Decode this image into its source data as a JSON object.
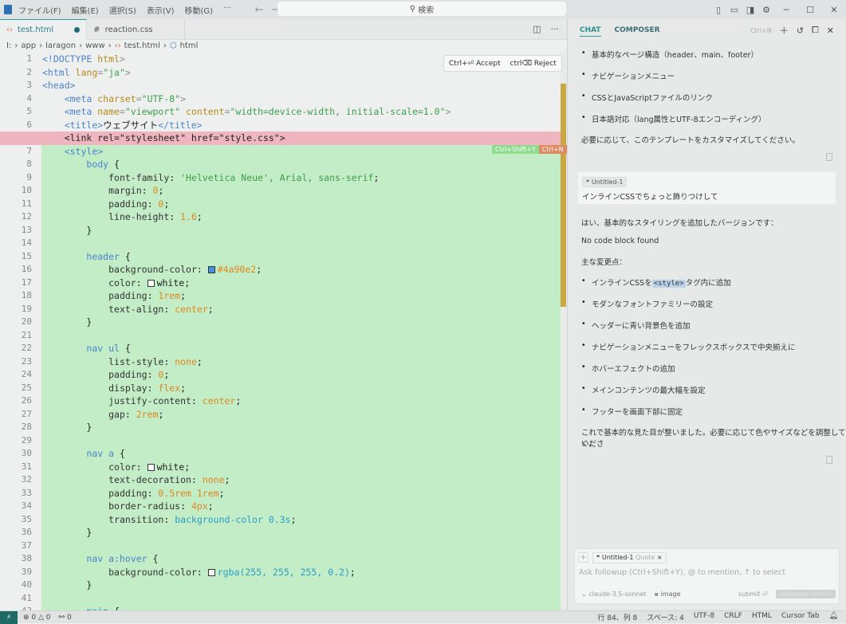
{
  "titlebar": {
    "menu": [
      "ファイル(F)",
      "編集(E)",
      "選択(S)",
      "表示(V)",
      "移動(G)",
      "···"
    ],
    "search_placeholder": "検索"
  },
  "tabs": [
    {
      "label": "test.html",
      "icon": "html-icon",
      "modified": true,
      "active": true
    },
    {
      "label": "reaction.css",
      "icon": "hash-icon",
      "active": false
    }
  ],
  "breadcrumb": [
    "I:",
    "app",
    "laragon",
    "www",
    "test.html",
    "html"
  ],
  "diff_actions": {
    "accept": "Ctrl+⏎ Accept",
    "reject": "ctrl⌫ Reject",
    "accept_short": "Ctrl+Shift+Y",
    "reject_short": "Ctrl+N",
    "accept_color": "#8fdc8f",
    "reject_color": "#e08a62"
  },
  "code": [
    {
      "n": "1",
      "seg": [
        [
          "t",
          "<!DOCTYPE "
        ],
        [
          "a",
          "html"
        ],
        [
          "p",
          ">"
        ]
      ]
    },
    {
      "n": "2",
      "seg": [
        [
          "t",
          "<html "
        ],
        [
          "a",
          "lang"
        ],
        [
          "p",
          "="
        ],
        [
          "s",
          "\"ja\""
        ],
        [
          "p",
          ">"
        ]
      ]
    },
    {
      "n": "3",
      "seg": [
        [
          "t",
          "<head>"
        ]
      ]
    },
    {
      "n": "4",
      "seg": [
        [
          "x",
          "    "
        ],
        [
          "t",
          "<meta "
        ],
        [
          "a",
          "charset"
        ],
        [
          "p",
          "="
        ],
        [
          "s",
          "\"UTF-8\""
        ],
        [
          "p",
          ">"
        ]
      ]
    },
    {
      "n": "5",
      "seg": [
        [
          "x",
          "    "
        ],
        [
          "t",
          "<meta "
        ],
        [
          "a",
          "name"
        ],
        [
          "p",
          "="
        ],
        [
          "s",
          "\"viewport\" "
        ],
        [
          "a",
          "content"
        ],
        [
          "p",
          "="
        ],
        [
          "s",
          "\"width=device-width, initial-scale=1.0\""
        ],
        [
          "p",
          ">"
        ]
      ]
    },
    {
      "n": "6",
      "seg": [
        [
          "x",
          "    "
        ],
        [
          "t",
          "<title>"
        ],
        [
          "x",
          "ウェブサイト"
        ],
        [
          "t",
          "</title>"
        ]
      ]
    },
    {
      "n": "",
      "type": "del",
      "seg": [
        [
          "x",
          "    <link rel=\"stylesheet\" href=\"style.css\">"
        ]
      ]
    },
    {
      "n": "7",
      "type": "add",
      "seg": [
        [
          "x",
          "    "
        ],
        [
          "t",
          "<style>"
        ]
      ]
    },
    {
      "n": "8",
      "type": "add",
      "seg": [
        [
          "x",
          "        "
        ],
        [
          "sel",
          "body"
        ],
        [
          "x",
          " {"
        ]
      ]
    },
    {
      "n": "9",
      "type": "add",
      "seg": [
        [
          "x",
          "            "
        ],
        [
          "prop",
          "font-family"
        ],
        [
          "x",
          ": "
        ],
        [
          "str",
          "'Helvetica Neue', Arial, sans-serif"
        ],
        [
          "x",
          ";"
        ]
      ]
    },
    {
      "n": "10",
      "type": "add",
      "seg": [
        [
          "x",
          "            "
        ],
        [
          "prop",
          "margin"
        ],
        [
          "x",
          ": "
        ],
        [
          "num",
          "0"
        ],
        [
          "x",
          ";"
        ]
      ]
    },
    {
      "n": "11",
      "type": "add",
      "seg": [
        [
          "x",
          "            "
        ],
        [
          "prop",
          "padding"
        ],
        [
          "x",
          ": "
        ],
        [
          "num",
          "0"
        ],
        [
          "x",
          ";"
        ]
      ]
    },
    {
      "n": "12",
      "type": "add",
      "seg": [
        [
          "x",
          "            "
        ],
        [
          "prop",
          "line-height"
        ],
        [
          "x",
          ": "
        ],
        [
          "num",
          "1.6"
        ],
        [
          "x",
          ";"
        ]
      ]
    },
    {
      "n": "13",
      "type": "add",
      "seg": [
        [
          "x",
          "        }"
        ]
      ]
    },
    {
      "n": "14",
      "type": "add",
      "seg": []
    },
    {
      "n": "15",
      "type": "add",
      "seg": [
        [
          "x",
          "        "
        ],
        [
          "sel",
          "header"
        ],
        [
          "x",
          " {"
        ]
      ]
    },
    {
      "n": "16",
      "type": "add",
      "seg": [
        [
          "x",
          "            "
        ],
        [
          "prop",
          "background-color"
        ],
        [
          "x",
          ": "
        ],
        [
          "sw",
          "#4a90e2"
        ],
        [
          "num",
          "#4a90e2"
        ],
        [
          "x",
          ";"
        ]
      ]
    },
    {
      "n": "17",
      "type": "add",
      "seg": [
        [
          "x",
          "            "
        ],
        [
          "prop",
          "color"
        ],
        [
          "x",
          ": "
        ],
        [
          "sw",
          "#ffffff"
        ],
        [
          "x",
          "white"
        ],
        [
          "x",
          ";"
        ]
      ]
    },
    {
      "n": "18",
      "type": "add",
      "seg": [
        [
          "x",
          "            "
        ],
        [
          "prop",
          "padding"
        ],
        [
          "x",
          ": "
        ],
        [
          "num",
          "1rem"
        ],
        [
          "x",
          ";"
        ]
      ]
    },
    {
      "n": "19",
      "type": "add",
      "seg": [
        [
          "x",
          "            "
        ],
        [
          "prop",
          "text-align"
        ],
        [
          "x",
          ": "
        ],
        [
          "kw",
          "center"
        ],
        [
          "x",
          ";"
        ]
      ]
    },
    {
      "n": "20",
      "type": "add",
      "seg": [
        [
          "x",
          "        }"
        ]
      ]
    },
    {
      "n": "21",
      "type": "add",
      "seg": []
    },
    {
      "n": "22",
      "type": "add",
      "seg": [
        [
          "x",
          "        "
        ],
        [
          "sel",
          "nav ul"
        ],
        [
          "x",
          " {"
        ]
      ]
    },
    {
      "n": "23",
      "type": "add",
      "seg": [
        [
          "x",
          "            "
        ],
        [
          "prop",
          "list-style"
        ],
        [
          "x",
          ": "
        ],
        [
          "kw",
          "none"
        ],
        [
          "x",
          ";"
        ]
      ]
    },
    {
      "n": "24",
      "type": "add",
      "seg": [
        [
          "x",
          "            "
        ],
        [
          "prop",
          "padding"
        ],
        [
          "x",
          ": "
        ],
        [
          "num",
          "0"
        ],
        [
          "x",
          ";"
        ]
      ]
    },
    {
      "n": "25",
      "type": "add",
      "seg": [
        [
          "x",
          "            "
        ],
        [
          "prop",
          "display"
        ],
        [
          "x",
          ": "
        ],
        [
          "kw",
          "flex"
        ],
        [
          "x",
          ";"
        ]
      ]
    },
    {
      "n": "26",
      "type": "add",
      "seg": [
        [
          "x",
          "            "
        ],
        [
          "prop",
          "justify-content"
        ],
        [
          "x",
          ": "
        ],
        [
          "kw",
          "center"
        ],
        [
          "x",
          ";"
        ]
      ]
    },
    {
      "n": "27",
      "type": "add",
      "seg": [
        [
          "x",
          "            "
        ],
        [
          "prop",
          "gap"
        ],
        [
          "x",
          ": "
        ],
        [
          "num",
          "2rem"
        ],
        [
          "x",
          ";"
        ]
      ]
    },
    {
      "n": "28",
      "type": "add",
      "seg": [
        [
          "x",
          "        }"
        ]
      ]
    },
    {
      "n": "29",
      "type": "add",
      "seg": []
    },
    {
      "n": "30",
      "type": "add",
      "seg": [
        [
          "x",
          "        "
        ],
        [
          "sel",
          "nav a"
        ],
        [
          "x",
          " {"
        ]
      ]
    },
    {
      "n": "31",
      "type": "add",
      "seg": [
        [
          "x",
          "            "
        ],
        [
          "prop",
          "color"
        ],
        [
          "x",
          ": "
        ],
        [
          "sw",
          "#ffffff"
        ],
        [
          "x",
          "white"
        ],
        [
          "x",
          ";"
        ]
      ]
    },
    {
      "n": "32",
      "type": "add",
      "seg": [
        [
          "x",
          "            "
        ],
        [
          "prop",
          "text-decoration"
        ],
        [
          "x",
          ": "
        ],
        [
          "kw",
          "none"
        ],
        [
          "x",
          ";"
        ]
      ]
    },
    {
      "n": "33",
      "type": "add",
      "seg": [
        [
          "x",
          "            "
        ],
        [
          "prop",
          "padding"
        ],
        [
          "x",
          ": "
        ],
        [
          "num",
          "0.5rem 1rem"
        ],
        [
          "x",
          ";"
        ]
      ]
    },
    {
      "n": "34",
      "type": "add",
      "seg": [
        [
          "x",
          "            "
        ],
        [
          "prop",
          "border-radius"
        ],
        [
          "x",
          ": "
        ],
        [
          "num",
          "4px"
        ],
        [
          "x",
          ";"
        ]
      ]
    },
    {
      "n": "35",
      "type": "add",
      "seg": [
        [
          "x",
          "            "
        ],
        [
          "prop",
          "transition"
        ],
        [
          "x",
          ": "
        ],
        [
          "fn",
          "background-color 0.3s"
        ],
        [
          "x",
          ";"
        ]
      ]
    },
    {
      "n": "36",
      "type": "add",
      "seg": [
        [
          "x",
          "        }"
        ]
      ]
    },
    {
      "n": "37",
      "type": "add",
      "seg": []
    },
    {
      "n": "38",
      "type": "add",
      "seg": [
        [
          "x",
          "        "
        ],
        [
          "sel",
          "nav a:hover"
        ],
        [
          "x",
          " {"
        ]
      ]
    },
    {
      "n": "39",
      "type": "add",
      "seg": [
        [
          "x",
          "            "
        ],
        [
          "prop",
          "background-color"
        ],
        [
          "x",
          ": "
        ],
        [
          "sw",
          "#ffffff"
        ],
        [
          "fn",
          "rgba(255, 255, 255, 0.2)"
        ],
        [
          "x",
          ";"
        ]
      ]
    },
    {
      "n": "40",
      "type": "add",
      "seg": [
        [
          "x",
          "        }"
        ]
      ]
    },
    {
      "n": "41",
      "type": "add",
      "seg": []
    },
    {
      "n": "42",
      "type": "add",
      "seg": [
        [
          "x",
          "        "
        ],
        [
          "sel",
          "main"
        ],
        [
          "x",
          " {"
        ]
      ]
    }
  ],
  "chat": {
    "tabs": [
      "CHAT",
      "COMPOSER"
    ],
    "new_hint": "Ctrl+N",
    "bullets_top": [
      "基本的なページ構造（header、main、footer）",
      "ナビゲーションメニュー",
      "CSSとJavaScriptファイルのリンク",
      "日本語対応（lang属性とUTF-8エンコーディング）"
    ],
    "closing_top": "必要に応じて、このテンプレートをカスタマイズしてください。",
    "user_quote": {
      "chip": "Untitled-1",
      "text": "インラインCSSでちょっと飾りつけして"
    },
    "reply_intro": "はい、基本的なスタイリングを追加したバージョンです：",
    "no_code": "No code block found",
    "changes_heading": "主な変更点：",
    "bullet_first": {
      "before": "インラインCSSを",
      "code": "<style>",
      "after": "タグ内に追加"
    },
    "bullets": [
      "モダンなフォントファミリーの設定",
      "ヘッダーに青い背景色を追加",
      "ナビゲーションメニューをフレックスボックスで中央揃えに",
      "ホバーエフェクトの追加",
      "メインコンテンツの最大幅を設定",
      "フッターを画面下部に固定"
    ],
    "closing_line1": "これで基本的な見た目が整いました。必要に応じて色やサイズなどを調整してくださ",
    "closing_line2": "い。",
    "input": {
      "chip": "Untitled-1",
      "chip_suffix": "Quote",
      "placeholder": "Ask followup (Ctrl+Shift+Y), @ to mention, ↑ to select",
      "model": "claude-3.5-sonnet",
      "image": "image",
      "submit": "submit ⏎",
      "codebase": "codebase ctrl+⏎"
    }
  },
  "status": {
    "errors": "0",
    "warnings": "0",
    "ports": "0",
    "position": "行 84、列 8",
    "spaces": "スペース: 4",
    "encoding": "UTF-8",
    "eol": "CRLF",
    "language": "HTML",
    "cursor_tab": "Cursor Tab"
  }
}
